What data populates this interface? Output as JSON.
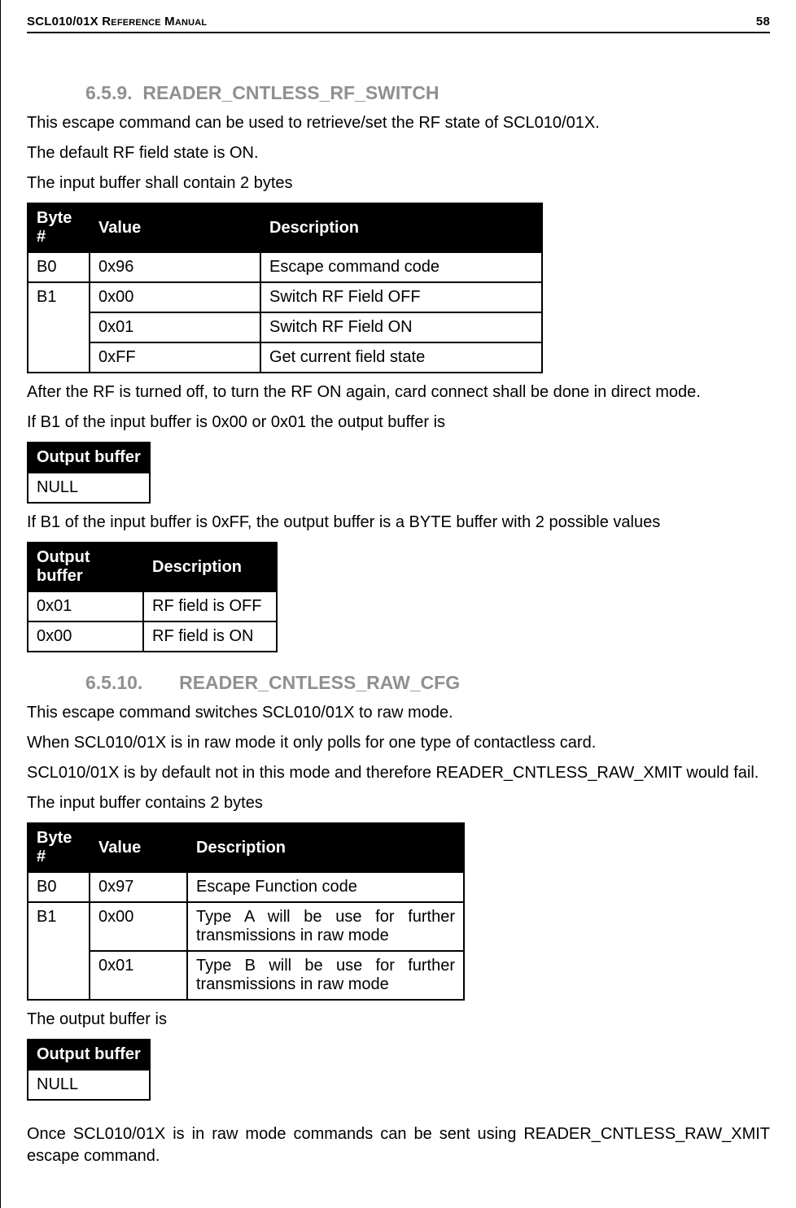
{
  "header": {
    "title": "SCL010/01X Reference Manual",
    "page_number": "58"
  },
  "section1": {
    "number": "6.5.9.",
    "title": "READER_CNTLESS_RF_SWITCH",
    "intro1": "This escape command can be used to retrieve/set the RF state of SCL010/01X.",
    "intro2": "The default RF field state is ON.",
    "intro3": "The input buffer shall contain 2 bytes",
    "table1_cols": {
      "c1": "Byte #",
      "c2": "Value",
      "c3": "Description"
    },
    "table1": {
      "r1": {
        "byte": "B0",
        "value": "0x96",
        "desc": "Escape command code"
      },
      "r2": {
        "byte": "B1",
        "value": "0x00",
        "desc": "Switch RF Field OFF"
      },
      "r3": {
        "value": "0x01",
        "desc": "Switch RF Field ON"
      },
      "r4": {
        "value": "0xFF",
        "desc": "Get current field state"
      }
    },
    "after1": "After the RF is turned off, to turn the RF ON again, card connect shall be done in direct mode.",
    "after2": "If B1 of the input buffer is 0x00 or 0x01 the output buffer is",
    "table2_cols": {
      "c1": "Output buffer"
    },
    "table2": {
      "r1": {
        "v": "NULL"
      }
    },
    "after3": "If B1 of the input buffer is 0xFF, the output buffer is a BYTE buffer with 2 possible values",
    "table3_cols": {
      "c1": "Output buffer",
      "c2": "Description"
    },
    "table3": {
      "r1": {
        "buf": "0x01",
        "desc": "RF field is OFF"
      },
      "r2": {
        "buf": "0x00",
        "desc": "RF field is ON"
      }
    }
  },
  "section2": {
    "number": "6.5.10.",
    "title": "READER_CNTLESS_RAW_CFG",
    "intro1": "This escape command switches SCL010/01X to raw mode.",
    "intro2": "When SCL010/01X is in raw mode it only polls for one type of contactless card.",
    "intro3": "SCL010/01X is by default not in this mode and therefore READER_CNTLESS_RAW_XMIT would fail.",
    "intro4": "The input buffer contains 2 bytes",
    "table4_cols": {
      "c1": "Byte #",
      "c2": "Value",
      "c3": "Description"
    },
    "table4": {
      "r1": {
        "byte": "B0",
        "value": "0x97",
        "desc": "Escape Function code"
      },
      "r2": {
        "byte": "B1",
        "value": "0x00",
        "desc": "Type A will be use for further transmissions in raw mode"
      },
      "r3": {
        "value": "0x01",
        "desc": "Type B will be use for further transmissions in raw mode"
      }
    },
    "after1": "The output buffer is",
    "table5_cols": {
      "c1": "Output buffer"
    },
    "table5": {
      "r1": {
        "v": "NULL"
      }
    },
    "after2": "Once SCL010/01X is in raw mode commands can be sent using READER_CNTLESS_RAW_XMIT escape command."
  }
}
